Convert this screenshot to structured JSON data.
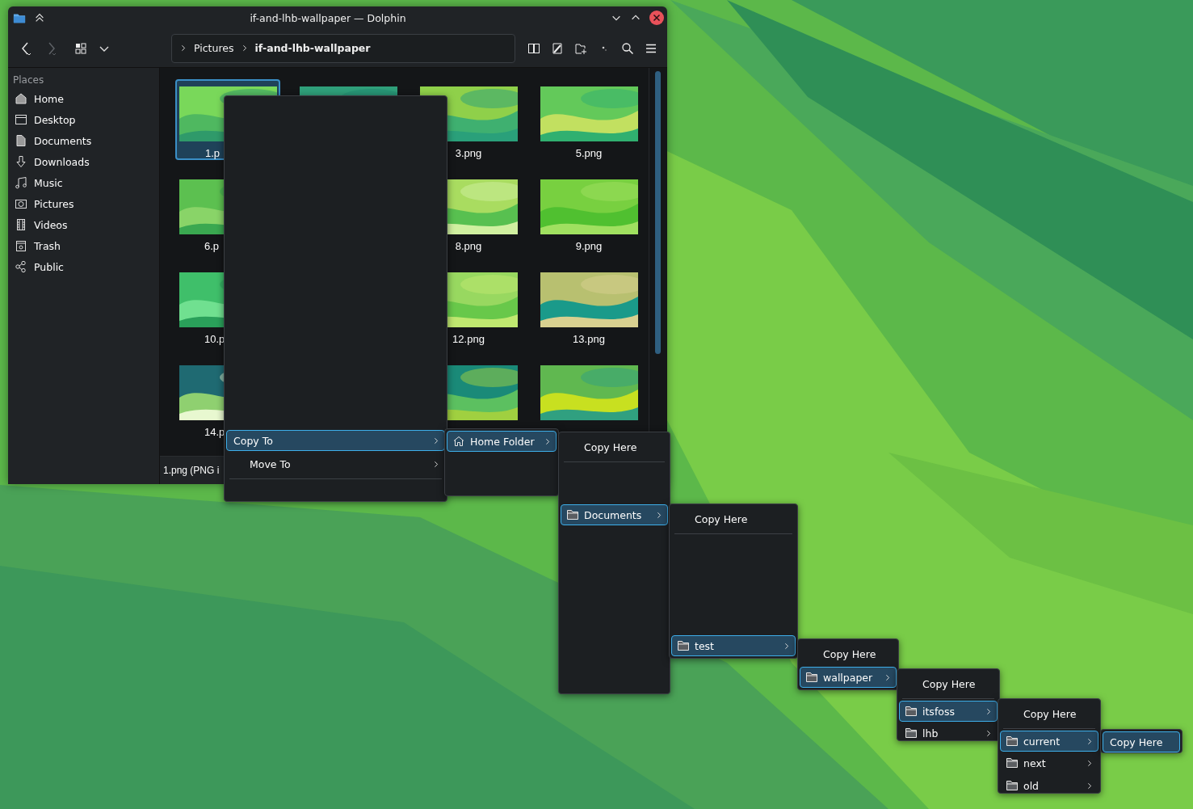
{
  "window": {
    "title": "if-and-lhb-wallpaper — Dolphin"
  },
  "toolbar": {
    "back": {
      "disabled": false
    },
    "forward": {
      "disabled": true
    }
  },
  "breadcrumbs": [
    {
      "label": "Pictures",
      "current": false
    },
    {
      "label": "if-and-lhb-wallpaper",
      "current": true
    }
  ],
  "sidebar": {
    "heading": "Places",
    "items": [
      {
        "label": "Home"
      },
      {
        "label": "Desktop"
      },
      {
        "label": "Documents"
      },
      {
        "label": "Downloads"
      },
      {
        "label": "Music"
      },
      {
        "label": "Pictures"
      },
      {
        "label": "Videos"
      },
      {
        "label": "Trash"
      },
      {
        "label": "Public"
      }
    ]
  },
  "files": [
    {
      "kind": "picture",
      "name": "1.p",
      "selected": true
    },
    {
      "kind": "picture",
      "selected": false
    },
    {
      "kind": "picture",
      "name": "3.png",
      "selected": false
    },
    {
      "kind": "picture",
      "name": "5.png",
      "selected": false
    },
    {
      "kind": "picture",
      "name": "6.p",
      "selected": false
    },
    {
      "kind": "picture",
      "name": "8.png",
      "selected": false
    },
    {
      "kind": "picture",
      "name": "9.png",
      "selected": false
    },
    {
      "kind": "picture",
      "name": "10.p",
      "selected": false
    },
    {
      "kind": "picture",
      "name": "12.png",
      "selected": false
    },
    {
      "kind": "picture",
      "name": "13.png",
      "selected": false
    },
    {
      "kind": "picture",
      "name": "14.p",
      "selected": false
    },
    {
      "kind": "picture",
      "selected": false
    },
    {
      "kind": "picture",
      "selected": false
    }
  ],
  "status_bar": {
    "text": "1.png (PNG i"
  },
  "menus": [
    {
      "items": [
        {
          "kind": "entry",
          "label": "Copy To",
          "selected": true,
          "submenu": true
        },
        {
          "kind": "entry",
          "label": "Move To",
          "selected": false,
          "submenu": true
        },
        {
          "kind": "separator"
        }
      ]
    },
    {
      "items": [
        {
          "kind": "home",
          "label": "Home Folder",
          "selected": true,
          "submenu": true
        }
      ]
    },
    {
      "items": [
        {
          "kind": "entry",
          "label": "Copy Here",
          "selected": false,
          "submenu": false
        },
        {
          "kind": "separator"
        },
        {
          "kind": "folder",
          "label": "Documents",
          "selected": true,
          "submenu": true
        }
      ]
    },
    {
      "items": [
        {
          "kind": "entry",
          "label": "Copy Here",
          "selected": false,
          "submenu": false
        },
        {
          "kind": "separator"
        },
        {
          "kind": "folder",
          "label": "test",
          "selected": true,
          "submenu": true
        }
      ]
    },
    {
      "items": [
        {
          "kind": "entry",
          "label": "Copy Here",
          "selected": false,
          "submenu": false
        },
        {
          "kind": "folder",
          "label": "wallpaper",
          "selected": true,
          "submenu": true
        }
      ]
    },
    {
      "items": [
        {
          "kind": "entry",
          "label": "Copy Here",
          "selected": false,
          "submenu": false
        },
        {
          "kind": "separator"
        },
        {
          "kind": "folder",
          "label": "itsfoss",
          "selected": true,
          "submenu": true
        },
        {
          "kind": "folder",
          "label": "lhb",
          "selected": false,
          "submenu": true
        }
      ]
    },
    {
      "items": [
        {
          "kind": "entry",
          "label": "Copy Here",
          "selected": false,
          "submenu": false
        },
        {
          "kind": "separator"
        },
        {
          "kind": "folder",
          "label": "current",
          "selected": true,
          "submenu": true
        },
        {
          "kind": "folder",
          "label": "next",
          "selected": false,
          "submenu": true
        },
        {
          "kind": "folder",
          "label": "old",
          "selected": false,
          "submenu": true
        }
      ]
    },
    {
      "items": [
        {
          "kind": "entry",
          "label": "Copy Here",
          "selected": true,
          "submenu": false
        }
      ]
    }
  ]
}
